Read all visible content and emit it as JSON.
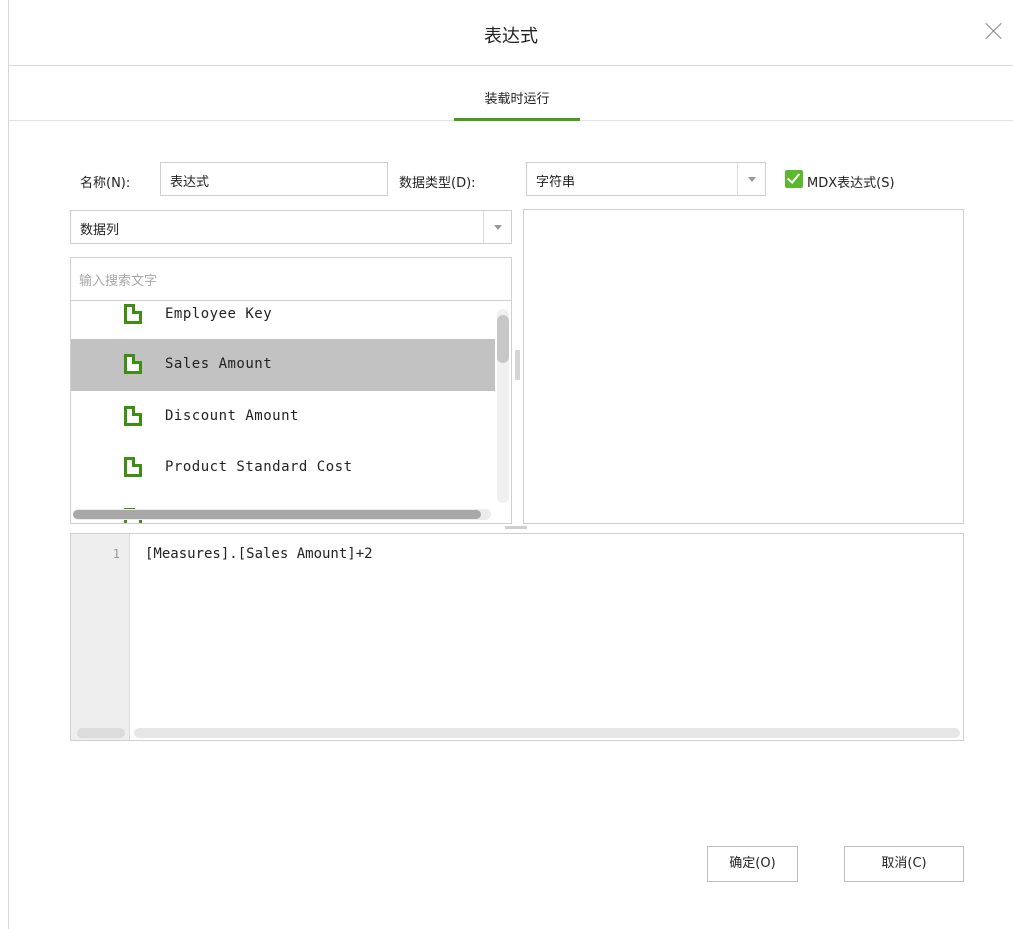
{
  "dialog": {
    "title": "表达式",
    "tab": "装载时运行"
  },
  "form": {
    "name_label": "名称(N):",
    "name_value": "表达式",
    "datatype_label": "数据类型(D):",
    "datatype_value": "字符串",
    "mdx_label": "MDX表达式(S)",
    "mdx_checked": true
  },
  "field_browser": {
    "category_value": "数据列",
    "search_placeholder": "输入搜索文字",
    "items": [
      {
        "label": "Employee Key",
        "selected": false
      },
      {
        "label": "Sales Amount",
        "selected": true
      },
      {
        "label": "Discount Amount",
        "selected": false
      },
      {
        "label": "Product Standard Cost",
        "selected": false
      }
    ]
  },
  "editor": {
    "line_number": "1",
    "code": "[Measures].[Sales Amount]+2"
  },
  "buttons": {
    "ok": "确定(O)",
    "cancel": "取消(C)"
  },
  "colors": {
    "accent": "#4a9a1c",
    "checkbox": "#5cb82e",
    "selection": "#c2c2c2"
  }
}
